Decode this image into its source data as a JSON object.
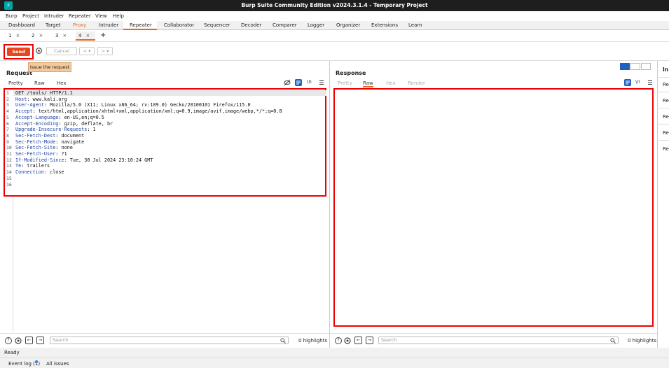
{
  "window": {
    "title": "Burp Suite Community Edition v2024.3.1.4 - Temporary Project",
    "app_icon_glyph": "⚡"
  },
  "menu": [
    "Burp",
    "Project",
    "Intruder",
    "Repeater",
    "View",
    "Help"
  ],
  "main_tabs": [
    "Dashboard",
    "Target",
    "Proxy",
    "Intruder",
    "Repeater",
    "Collaborator",
    "Sequencer",
    "Decoder",
    "Comparer",
    "Logger",
    "Organizer",
    "Extensions",
    "Learn"
  ],
  "main_tabs_active": "Repeater",
  "sub_tabs": [
    "1",
    "2",
    "3",
    "4"
  ],
  "sub_tab_close": "×",
  "sub_tab_add": "+",
  "toolbar": {
    "send": "Send",
    "cancel": "Cancel",
    "prev": "<",
    "next": ">",
    "dropdown": "▾",
    "tooltip": "Issue the request"
  },
  "request": {
    "title": "Request",
    "tabs": [
      "Pretty",
      "Raw",
      "Hex"
    ],
    "ln_icon": "\\n",
    "lines": [
      {
        "name": "",
        "value": "GET /tools/ HTTP/1.1"
      },
      {
        "name": "Host",
        "value": " www.kali.org"
      },
      {
        "name": "User-Agent",
        "value": " Mozilla/5.0 (X11; Linux x86_64; rv:109.0) Gecko/20100101 Firefox/115.0"
      },
      {
        "name": "Accept",
        "value": " text/html,application/xhtml+xml,application/xml;q=0.9,image/avif,image/webp,*/*;q=0.8"
      },
      {
        "name": "Accept-Language",
        "value": " en-US,en;q=0.5"
      },
      {
        "name": "Accept-Encoding",
        "value": " gzip, deflate, br"
      },
      {
        "name": "Upgrade-Insecure-Requests",
        "value": " 1"
      },
      {
        "name": "Sec-Fetch-Dest",
        "value": " document"
      },
      {
        "name": "Sec-Fetch-Mode",
        "value": " navigate"
      },
      {
        "name": "Sec-Fetch-Site",
        "value": " none"
      },
      {
        "name": "Sec-Fetch-User",
        "value": " ?1"
      },
      {
        "name": "If-Modified-Since",
        "value": " Tue, 30 Jul 2024 23:10:24 GMT"
      },
      {
        "name": "Te",
        "value": " trailers"
      },
      {
        "name": "Connection",
        "value": " close"
      },
      {
        "name": "",
        "value": ""
      },
      {
        "name": "",
        "value": ""
      }
    ],
    "search_placeholder": "Search",
    "highlights": "0 highlights"
  },
  "response": {
    "title": "Response",
    "tabs": [
      "Pretty",
      "Raw",
      "Hex",
      "Render"
    ],
    "ln_icon": "\\n",
    "search_placeholder": "Search",
    "highlights": "0 highlights"
  },
  "inspector": {
    "title": "In",
    "items": [
      "Re",
      "Re",
      "Re",
      "Re",
      "Re"
    ]
  },
  "status": "Ready",
  "footer": {
    "event_log": "Event log (1)",
    "all_issues": "All issues"
  },
  "colors": {
    "accent": "#e8661e",
    "send": "#e8461e",
    "highlight_border": "#ee0000",
    "header_name": "#1a3fa0"
  }
}
